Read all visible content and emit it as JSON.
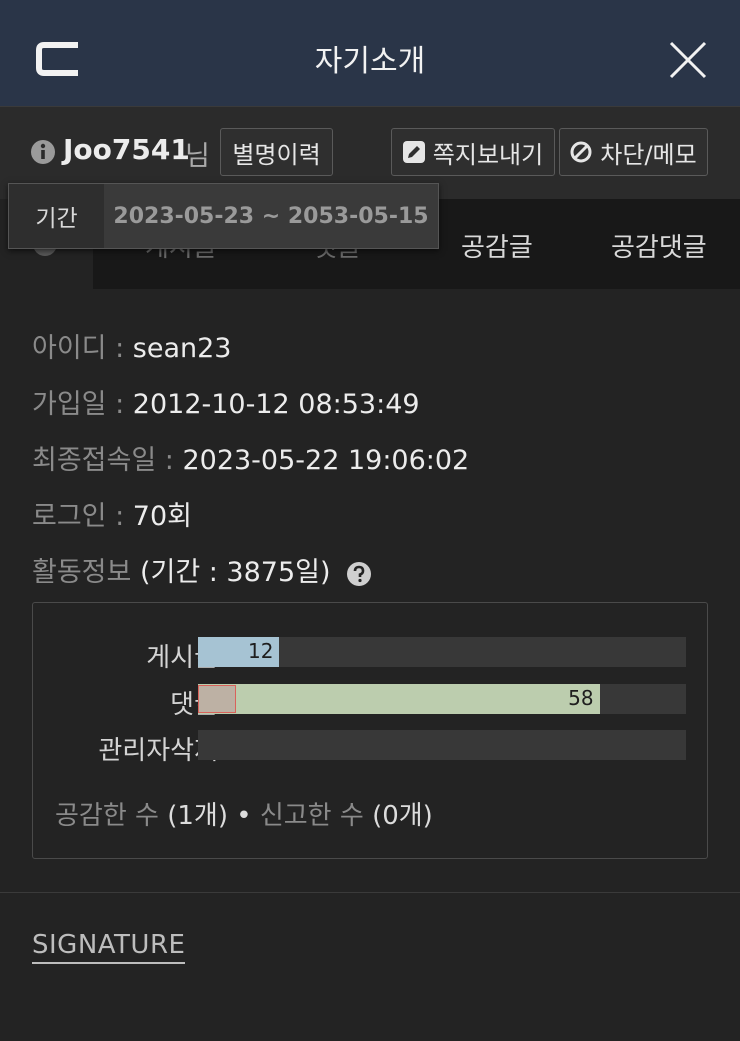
{
  "header": {
    "title": "자기소개",
    "back_icon": "back-icon",
    "close_icon": "close-icon"
  },
  "user": {
    "nickname": "Joo7541",
    "honorific": "님",
    "alias_history_label": "별명이력",
    "send_message_label": "쪽지보내기",
    "block_memo_label": "차단/메모"
  },
  "tooltip": {
    "label": "기간",
    "value": "2023-05-23 ~ 2053-05-15"
  },
  "tabs": [
    {
      "label": "게시글"
    },
    {
      "label": "댓글"
    },
    {
      "label": "공감글"
    },
    {
      "label": "공감댓글"
    }
  ],
  "profile": {
    "id_label": "아이디 : ",
    "id_value": "sean23",
    "joined_label": "가입일 : ",
    "joined_value": "2012-10-12 08:53:49",
    "last_login_label": "최종접속일 : ",
    "last_login_value": "2023-05-22 19:06:02",
    "login_label": "로그인 : ",
    "login_value": "70회",
    "activity_label": "활동정보 ",
    "activity_value": "(기간 : 3875일)"
  },
  "stats": {
    "posts_label": "게시글",
    "posts_value": "12",
    "posts_fraction": 0.167,
    "posts_color": "#a6c3d3",
    "comments_label": "댓글",
    "comments_value": "58",
    "comments_fraction": 0.823,
    "comments_color": "#bccdae",
    "admin_delete_label": "관리자삭제",
    "admin_delete_fraction": 0,
    "likes_label": "공감한 수 ",
    "likes_value": "(1개)",
    "bullet": " • ",
    "reports_label": "신고한 수 ",
    "reports_value": "(0개)"
  },
  "signature": {
    "label": "SIGNATURE"
  }
}
